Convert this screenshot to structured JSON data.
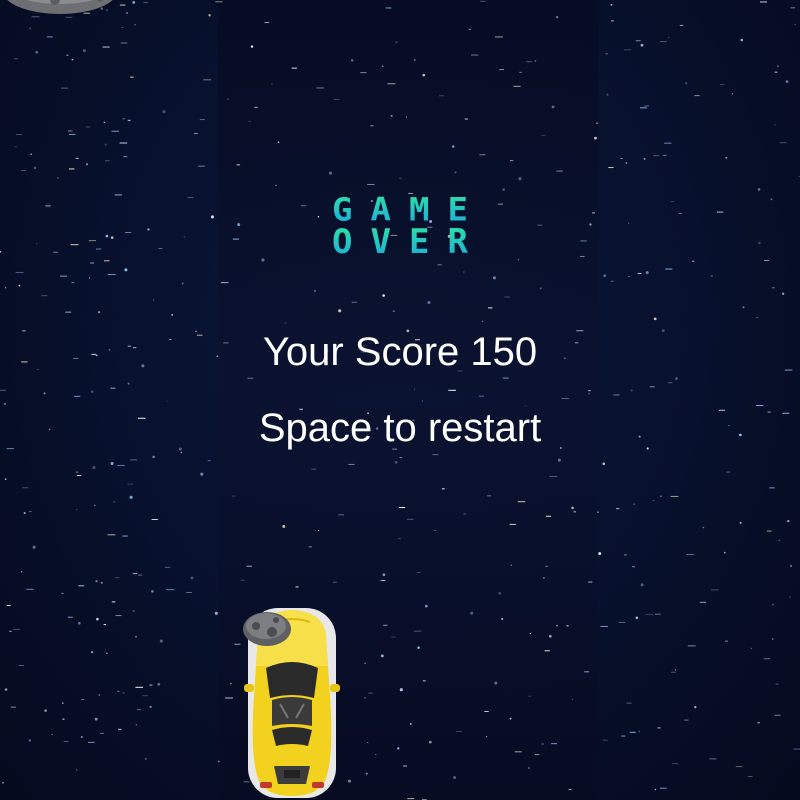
{
  "game": {
    "title_line1": "GAME",
    "title_line2": "OVER",
    "score_label": "Your Score",
    "score_value": "150",
    "score_text": "Your Score 150",
    "restart_text": "Space to restart"
  },
  "colors": {
    "title_gradient_top": "#2fe6a0",
    "title_gradient_bottom": "#1aa8e0",
    "text": "#ffffff",
    "car_body": "#f2d21e",
    "space": "#081230"
  },
  "sprites": {
    "player": "yellow-sports-car",
    "obstacle": "asteroid"
  }
}
